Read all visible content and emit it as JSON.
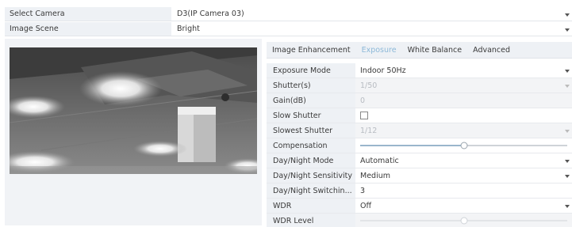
{
  "select_camera": {
    "label": "Select Camera",
    "value": "D3(IP Camera 03)"
  },
  "image_scene": {
    "label": "Image Scene",
    "value": "Bright"
  },
  "tabs": [
    {
      "label": "Image Enhancement",
      "active": false
    },
    {
      "label": "Exposure",
      "active": true
    },
    {
      "label": "White Balance",
      "active": false
    },
    {
      "label": "Advanced",
      "active": false
    }
  ],
  "exposure": {
    "exposure_mode": {
      "label": "Exposure Mode",
      "value": "Indoor 50Hz"
    },
    "shutter": {
      "label": "Shutter(s)",
      "value": "1/50"
    },
    "gain": {
      "label": "Gain(dB)",
      "value": "0"
    },
    "slow_shutter": {
      "label": "Slow Shutter",
      "checked": false
    },
    "slowest_shutter": {
      "label": "Slowest Shutter",
      "value": "1/12"
    },
    "compensation": {
      "label": "Compensation",
      "level": 0.5
    },
    "day_night_mode": {
      "label": "Day/Night Mode",
      "value": "Automatic"
    },
    "day_night_sensitivity": {
      "label": "Day/Night Sensitivity",
      "value": "Medium"
    },
    "day_night_switching": {
      "label": "Day/Night Switchin...",
      "value": "3"
    },
    "wdr": {
      "label": "WDR",
      "value": "Off"
    },
    "wdr_level": {
      "label": "WDR Level",
      "level": 0.5
    }
  },
  "colors": {
    "active_tab": "#8cb8d8",
    "label_bg": "#eef1f5",
    "slider_fill": "#9ab6cc"
  }
}
